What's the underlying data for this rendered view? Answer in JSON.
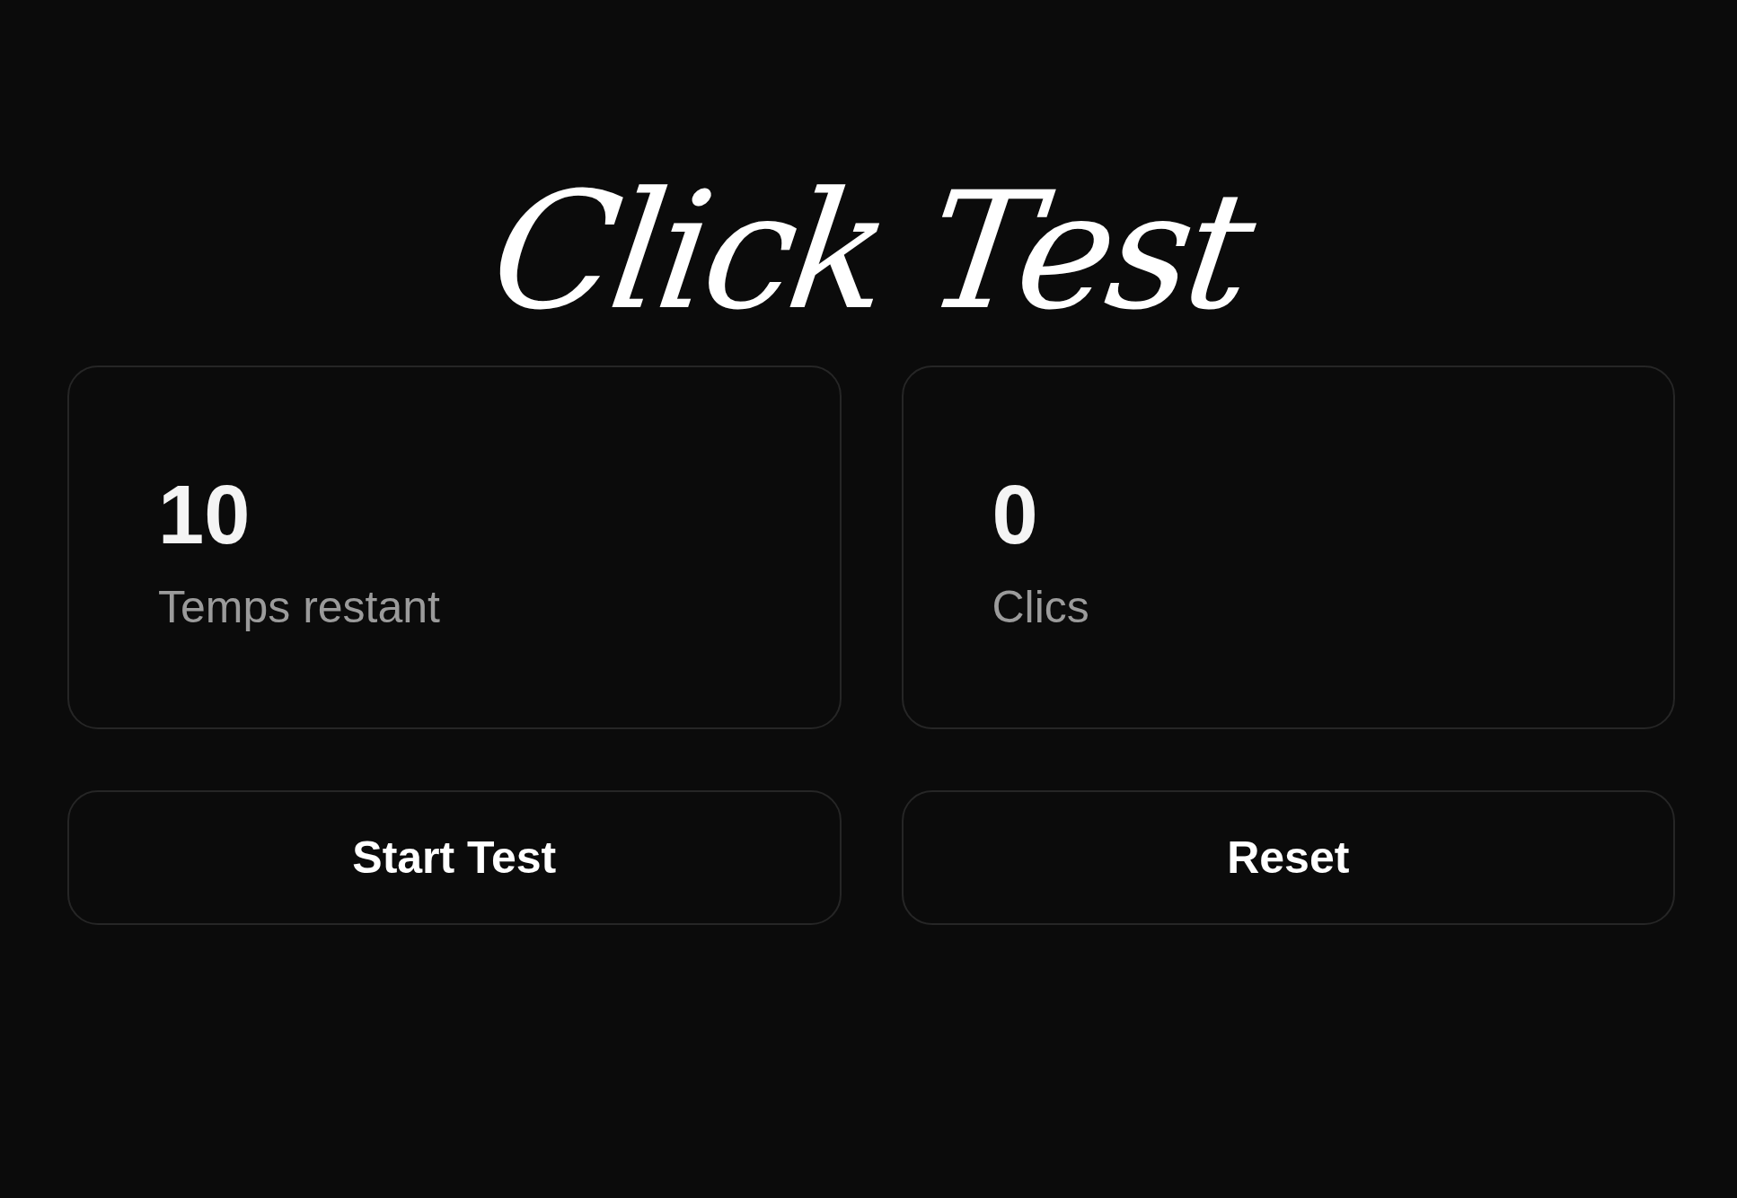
{
  "title": "Click Test",
  "stats": [
    {
      "value": "10",
      "label": "Temps restant"
    },
    {
      "value": "0",
      "label": "Clics"
    }
  ],
  "buttons": [
    {
      "label": "Start Test"
    },
    {
      "label": "Reset"
    }
  ]
}
